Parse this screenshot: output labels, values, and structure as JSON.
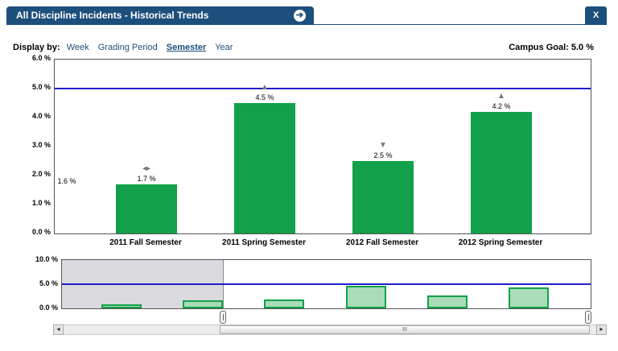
{
  "header": {
    "title": "All Discipline Incidents - Historical Trends",
    "go_icon_glyph": "➔",
    "close_label": "X"
  },
  "display_by": {
    "label": "Display by:",
    "options": [
      "Week",
      "Grading Period",
      "Semester",
      "Year"
    ],
    "selected": "Semester"
  },
  "campus_goal": "Campus Goal: 5.0 %",
  "colors": {
    "bar": "#12a14a",
    "goal_line": "#1f1fcf",
    "header": "#1d4f7c",
    "navigator_bar": "#a8ddb8"
  },
  "chart_data": [
    {
      "type": "bar",
      "categories": [
        "",
        "2011 Fall Semester",
        "2011 Spring Semester",
        "2012 Fall Semester",
        "2012 Spring Semester"
      ],
      "values": [
        1.6,
        1.7,
        4.5,
        2.5,
        4.2
      ],
      "value_labels": [
        "1.6 %",
        "1.7 %",
        "4.5 %",
        "2.5 %",
        "4.2 %"
      ],
      "trend_icons": [
        "none",
        "left-right-arrows-icon",
        "up-triangle-icon",
        "down-triangle-icon",
        "up-triangle-icon"
      ],
      "goal_line": 5.0,
      "ylim": [
        0,
        6
      ],
      "ytick_labels": [
        "6.0 %",
        "5.0 %",
        "4.0 %",
        "3.0 %",
        "2.0 %",
        "1.0 %",
        "0.0 %"
      ],
      "grid": false
    },
    {
      "type": "bar",
      "role": "navigator",
      "values": [
        0.8,
        1.7,
        1.8,
        4.6,
        2.6,
        4.3
      ],
      "goal_line": 5.0,
      "ylim": [
        0,
        10
      ],
      "ytick_labels": [
        "10.0 %",
        "5.0 %",
        "0.0 %"
      ]
    }
  ],
  "scrollbar": {
    "left_arrow": "◄",
    "right_arrow": "►",
    "grip": "III"
  }
}
